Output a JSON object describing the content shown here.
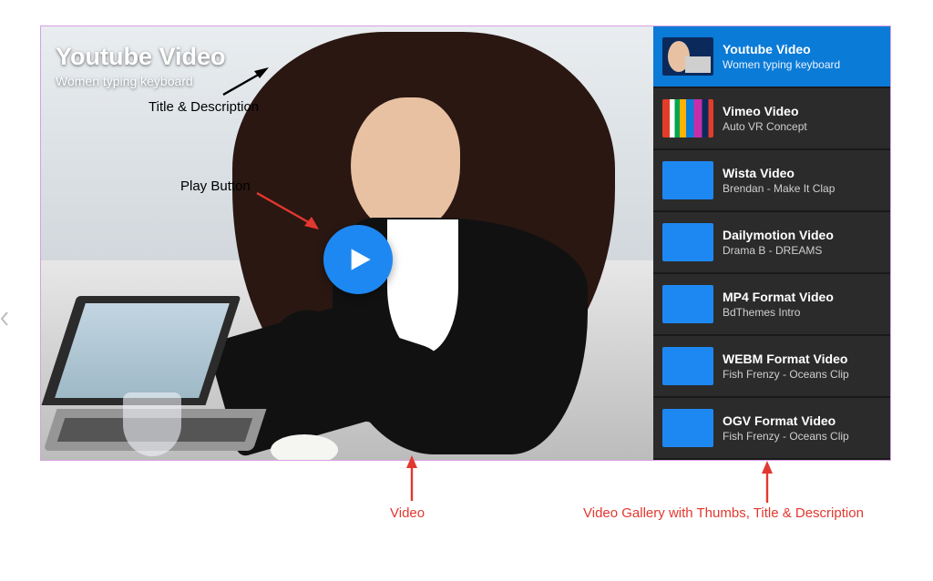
{
  "overlay": {
    "title": "Youtube Video",
    "subtitle": "Women typing keyboard"
  },
  "gallery": [
    {
      "title": "Youtube Video",
      "desc": "Women typing keyboard",
      "thumb": "photo",
      "active": true
    },
    {
      "title": "Vimeo Video",
      "desc": "Auto VR Concept",
      "thumb": "stripes",
      "active": false
    },
    {
      "title": "Wista Video",
      "desc": "Brendan - Make It Clap",
      "thumb": "blue",
      "active": false
    },
    {
      "title": "Dailymotion Video",
      "desc": "Drama B - DREAMS",
      "thumb": "blue",
      "active": false
    },
    {
      "title": "MP4 Format Video",
      "desc": "BdThemes Intro",
      "thumb": "blue",
      "active": false
    },
    {
      "title": "WEBM Format Video",
      "desc": "Fish Frenzy - Oceans Clip",
      "thumb": "blue",
      "active": false
    },
    {
      "title": "OGV Format Video",
      "desc": "Fish Frenzy - Oceans Clip",
      "thumb": "blue",
      "active": false
    }
  ],
  "annotations": {
    "title_desc": "Title & Description",
    "play_button": "Play Button",
    "video": "Video",
    "gallery": "Video Gallery with Thumbs, Title & Description"
  }
}
